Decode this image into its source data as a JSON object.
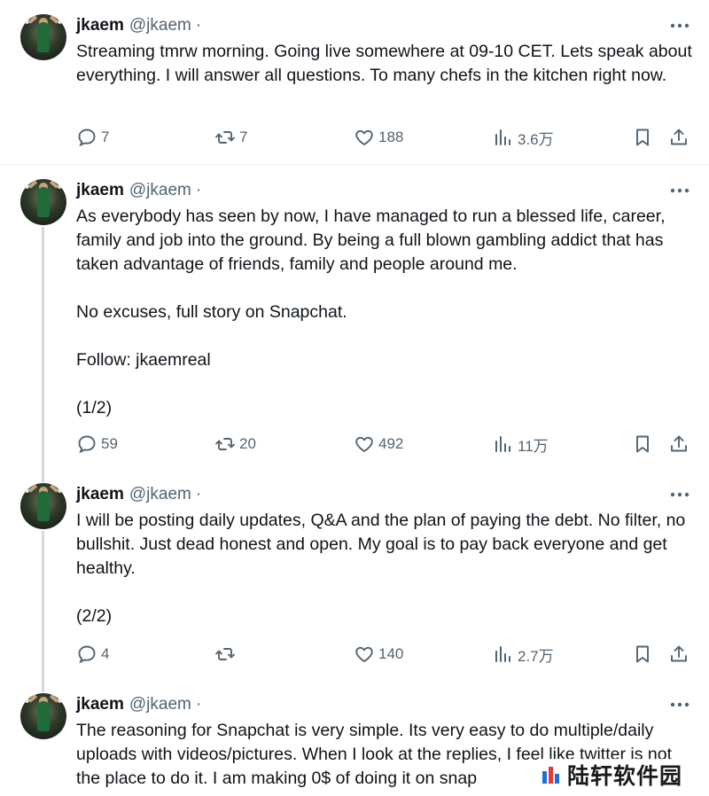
{
  "tweets": [
    {
      "name": "jkaem",
      "handle": "@jkaem",
      "sep": "·",
      "text": "Streaming tmrw morning. Going live somewhere at 09-10 CET. Lets speak about everything. I will answer all questions. To many chefs in the kitchen right now.",
      "replies": "7",
      "retweets": "7",
      "likes": "188",
      "views": "3.6万"
    },
    {
      "name": "jkaem",
      "handle": "@jkaem",
      "sep": "·",
      "text": "As everybody has seen by now, I have managed to run a blessed life, career, family and job into the ground. By being a full blown gambling addict that has taken advantage of friends, family and people around me.\n\nNo excuses, full story on Snapchat.\n\nFollow: jkaemreal\n\n(1/2)",
      "replies": "59",
      "retweets": "20",
      "likes": "492",
      "views": "11万"
    },
    {
      "name": "jkaem",
      "handle": "@jkaem",
      "sep": "·",
      "text": "I will be posting daily updates, Q&A and the plan of paying the debt. No filter, no bullshit. Just dead honest and open. My goal is to pay back everyone and get healthy.\n\n(2/2)",
      "replies": "4",
      "retweets": "",
      "likes": "140",
      "views": "2.7万"
    },
    {
      "name": "jkaem",
      "handle": "@jkaem",
      "sep": "·",
      "text": "The reasoning for Snapchat is very simple. Its very easy to do multiple/daily uploads with videos/pictures. When I look at the replies, I feel like twitter is not the place to do it. I am making 0$ of doing it on snap",
      "replies": "",
      "retweets": "",
      "likes": "",
      "views": ""
    }
  ],
  "icons": {
    "reply": "reply-icon",
    "retweet": "retweet-icon",
    "like": "heart-icon",
    "views": "views-bar-icon",
    "bookmark": "bookmark-icon",
    "share": "share-icon",
    "more": "more-dots-icon"
  },
  "watermark": {
    "text": "陆轩软件园"
  },
  "colors": {
    "text": "#0f1419",
    "secondary": "#536471",
    "thread_line": "#cfd9de",
    "divider": "#eff3f4"
  }
}
